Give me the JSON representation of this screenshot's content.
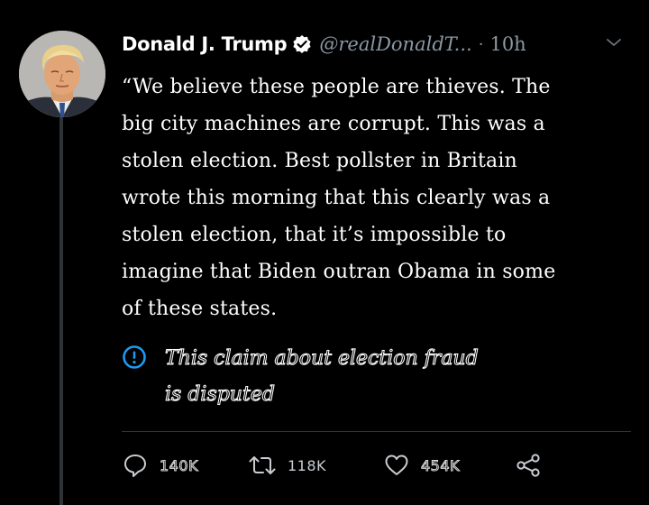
{
  "tweet": {
    "author_name": "Donald J. Trump",
    "handle": "@realDonaldT...",
    "separator": "·",
    "time": "10h",
    "text": "“We believe these people are thieves. The\nbig city machines are corrupt. This was a\nstolen election. Best pollster in Britain\nwrote this morning that this clearly was a\nstolen election, that it’s impossible to\nimagine that Biden outran Obama in some\nof these states.",
    "notice": "This claim about election fraud\nis disputed",
    "notice_icon": "exclamation-circle-icon"
  },
  "actions": {
    "replies": "140K",
    "retweets": "118K",
    "likes": "454K"
  },
  "icons": {
    "reply": "speech-bubble-icon",
    "retweet": "retweet-icon",
    "like": "heart-icon",
    "share": "share-icon",
    "menu": "chevron-down-icon",
    "verified": "verified-badge-icon"
  },
  "colors": {
    "background": "#000000",
    "text": "#ffffff",
    "muted": "#8b98a5",
    "thread_line": "#2f3336",
    "notice_icon": "#1d9bf0"
  }
}
